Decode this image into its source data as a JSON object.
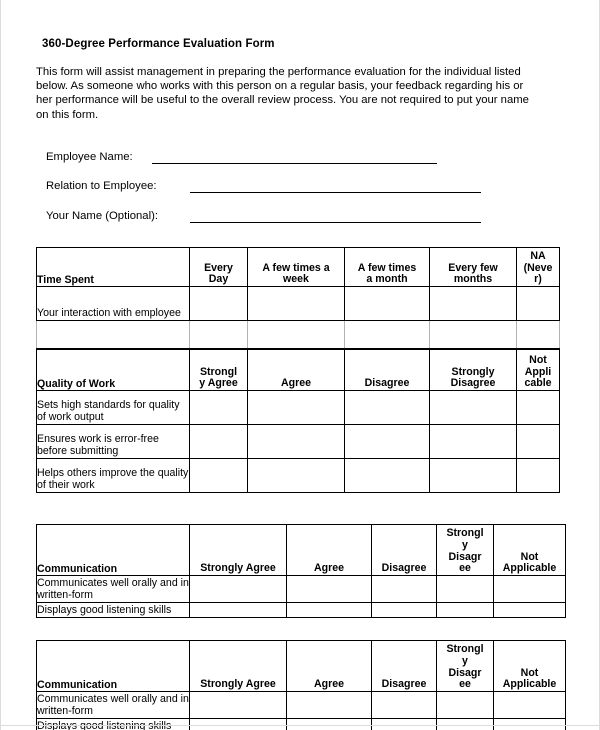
{
  "document": {
    "title": "360-Degree Performance Evaluation Form",
    "intro": "This form will assist management in preparing the performance evaluation for the individual listed below.  As someone who works with this person on a regular basis, your feedback regarding his or her performance will be useful to the overall review process.  You are not required to put your name on this form."
  },
  "fields": [
    {
      "label": "Employee Name:",
      "value": ""
    },
    {
      "label": "Relation to Employee:",
      "value": ""
    },
    {
      "label": "Your Name (Optional):",
      "value": ""
    }
  ],
  "tables": [
    {
      "id": "time-spent",
      "category": "Time Spent",
      "headers": [
        "Every\nDay",
        "A few times a\nweek",
        "A few times\na month",
        "Every few\nmonths",
        "NA\n(Neve\nr)"
      ],
      "rows": [
        "Your interaction with employee"
      ],
      "has_spacer_row": true
    },
    {
      "id": "quality-of-work",
      "category": "Quality of Work",
      "headers": [
        "Strongl\ny Agree",
        "Agree",
        "Disagree",
        "Strongly\nDisagree",
        "Not\nAppli\ncable"
      ],
      "rows": [
        "Sets high standards for quality of work output",
        "Ensures work is error-free before submitting",
        "Helps others improve the quality of their work"
      ],
      "has_spacer_row": false
    },
    {
      "id": "communication-1",
      "category": "Communication",
      "headers": [
        "Strongly Agree",
        "Agree",
        "Disagree",
        "Strongl\ny\nDisagr\nee",
        "Not\nApplicable"
      ],
      "rows": [
        "Communicates well orally and in written-form",
        "Displays good listening skills"
      ],
      "has_spacer_row": false
    },
    {
      "id": "communication-2",
      "category": "Communication",
      "headers": [
        "Strongly Agree",
        "Agree",
        "Disagree",
        "Strongl\ny\nDisagr\nee",
        "Not\nApplicable"
      ],
      "rows": [
        "Communicates well orally and in written-form",
        "Displays good listening skills"
      ],
      "has_spacer_row": false
    }
  ]
}
